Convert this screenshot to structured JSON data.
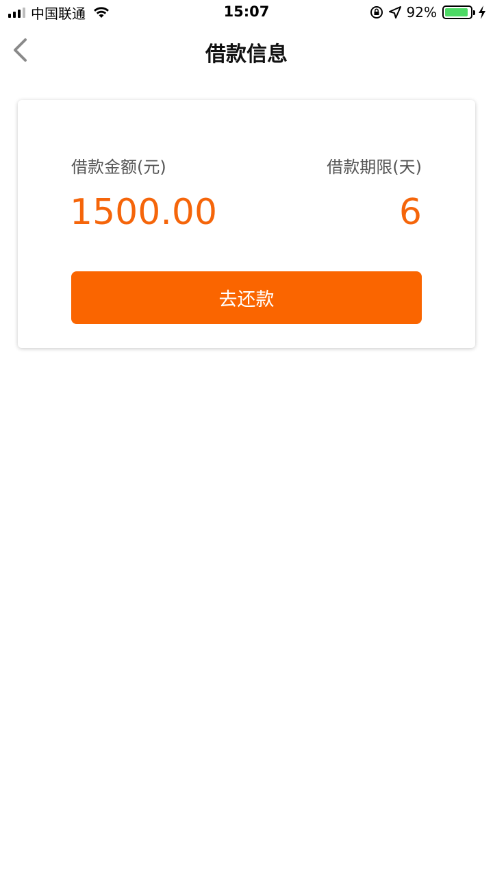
{
  "status_bar": {
    "carrier": "中国联通",
    "time": "15:07",
    "battery_percent": "92%",
    "battery_level": 0.92,
    "battery_color": "#4cd964"
  },
  "nav": {
    "title": "借款信息",
    "back_icon": "chevron-left-icon"
  },
  "loan": {
    "amount_label": "借款金额(元)",
    "amount_value": "1500.00",
    "term_label": "借款期限(天)",
    "term_value": "6",
    "repay_button": "去还款"
  },
  "colors": {
    "accent": "#fa6500",
    "value_text": "#f5650a"
  }
}
